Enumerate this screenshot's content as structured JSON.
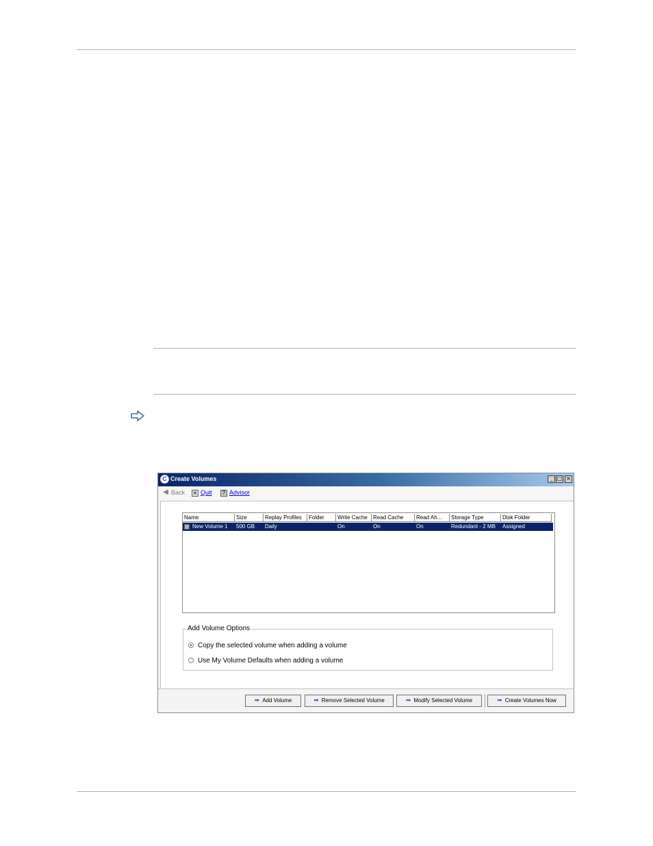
{
  "dialog": {
    "title": "Create Volumes",
    "window_controls": [
      "_",
      "□",
      "×"
    ],
    "toolbar": {
      "back": "Back",
      "quit": "Quit",
      "advisor": "Advisor"
    },
    "table": {
      "columns": [
        "Name",
        "Size",
        "Replay Profiles",
        "Folder",
        "Write Cache",
        "Read Cache",
        "Read Ah...",
        "Storage Type",
        "Disk Folder"
      ],
      "rows": [
        {
          "name": "New Volume 1",
          "size": "500 GB",
          "replay_profiles": "Daily",
          "folder": "",
          "write_cache": "On",
          "read_cache": "On",
          "read_ahead": "On",
          "storage_type": "Redundant - 2 MB",
          "disk_folder": "Assigned"
        }
      ]
    },
    "options": {
      "legend": "Add Volume Options",
      "copy_selected": "Copy the selected volume when adding a volume",
      "use_defaults": "Use My Volume Defaults when adding a volume",
      "selected": "copy_selected"
    },
    "buttons": {
      "add_volume": "Add Volume",
      "remove_selected": "Remove Selected Volume",
      "modify_selected": "Modify Selected Volume",
      "create_now": "Create Volumes Now"
    }
  }
}
